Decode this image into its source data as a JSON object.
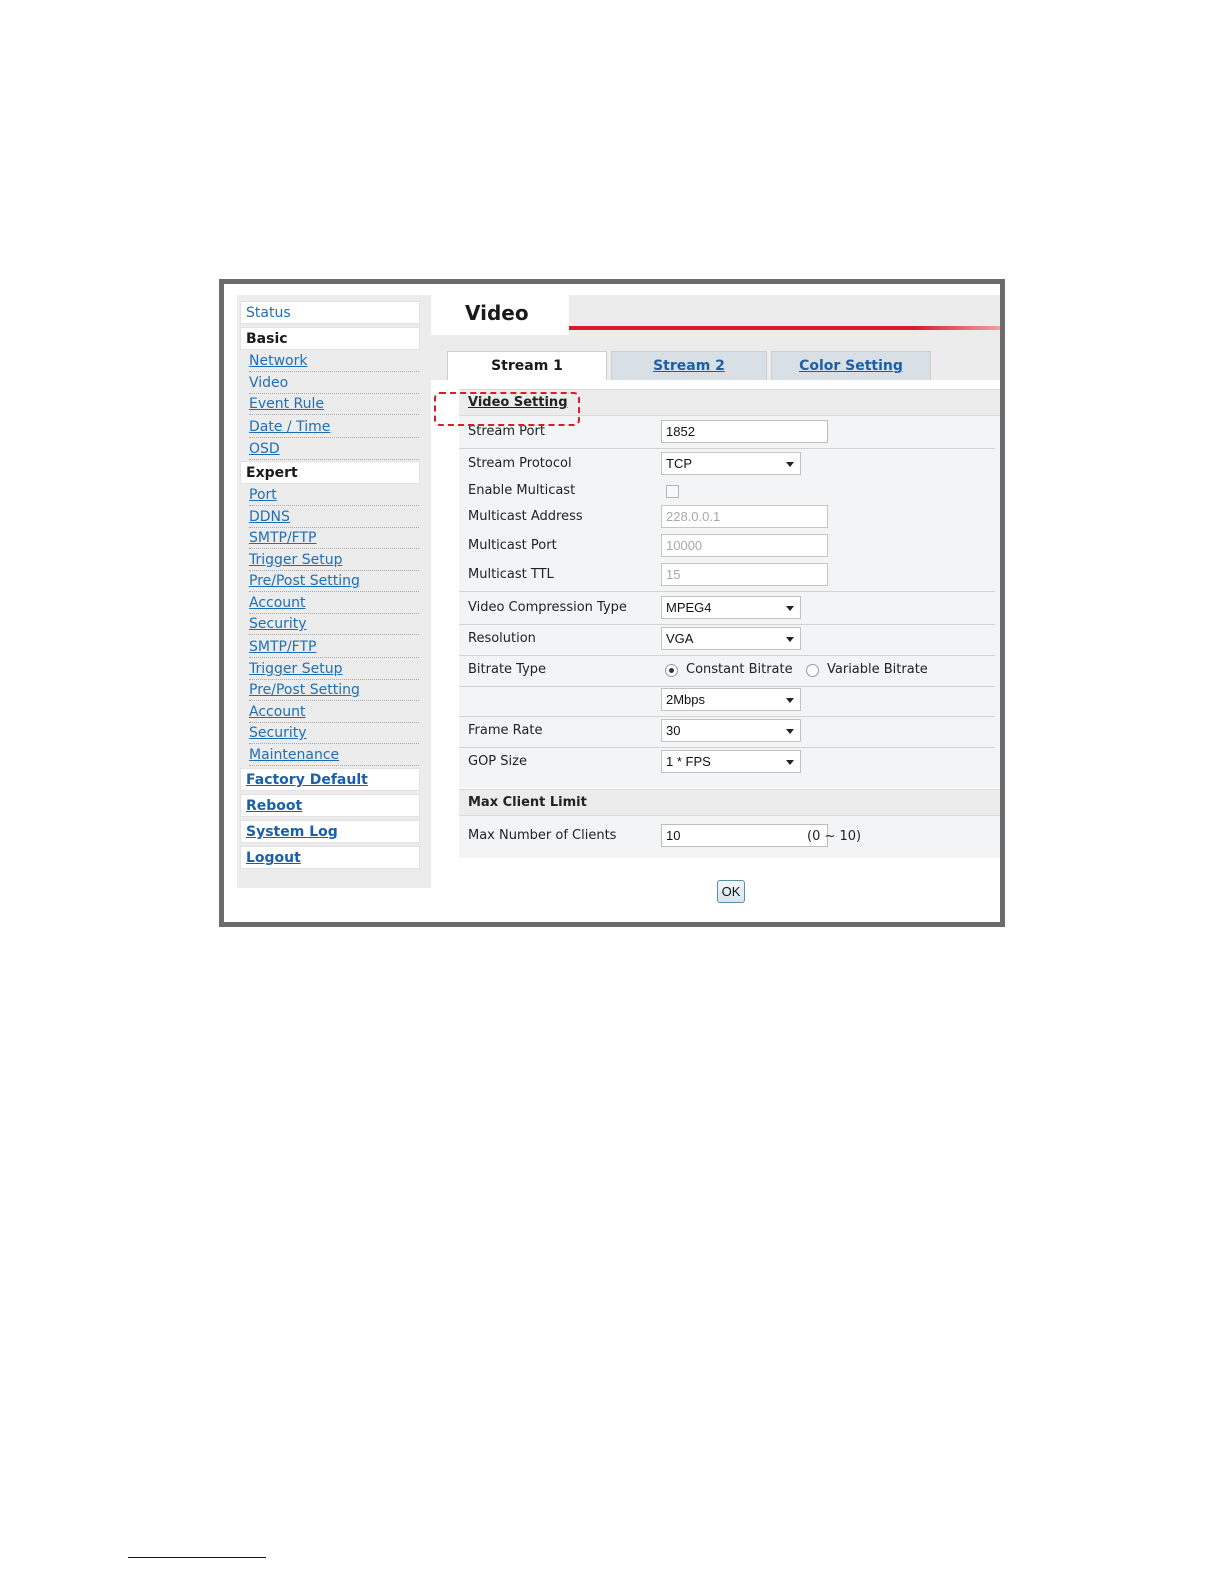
{
  "sidebar": {
    "status": "Status",
    "basic_header": "Basic",
    "basic_items": [
      "Network",
      "Video",
      "Event Rule",
      "Date / Time",
      "OSD"
    ],
    "expert_header": "Expert",
    "expert_items": [
      "Port",
      "DDNS",
      "SMTP/FTP",
      "Trigger Setup",
      "Pre/Post Setting",
      "Account",
      "Security",
      "SMTP/FTP",
      "Trigger Setup",
      "Pre/Post Setting",
      "Account",
      "Security",
      "Maintenance"
    ],
    "factory_default": "Factory Default",
    "reboot": "Reboot",
    "system_log": "System Log",
    "logout": "Logout"
  },
  "page": {
    "title": "Video"
  },
  "tabs": [
    "Stream 1",
    "Stream 2",
    "Color Setting"
  ],
  "video_setting": {
    "header": "Video Setting",
    "stream_port_label": "Stream Port",
    "stream_port_value": "1852",
    "stream_protocol_label": "Stream Protocol",
    "stream_protocol_value": "TCP",
    "enable_multicast_label": "Enable Multicast",
    "multicast_address_label": "Multicast Address",
    "multicast_address_value": "228.0.0.1",
    "multicast_port_label": "Multicast Port",
    "multicast_port_value": "10000",
    "multicast_ttl_label": "Multicast TTL",
    "multicast_ttl_value": "15",
    "compression_label": "Video Compression Type",
    "compression_value": "MPEG4",
    "resolution_label": "Resolution",
    "resolution_value": "VGA",
    "bitrate_type_label": "Bitrate Type",
    "bitrate_constant": "Constant Bitrate",
    "bitrate_variable": "Variable Bitrate",
    "bitrate_value": "2Mbps",
    "frame_rate_label": "Frame Rate",
    "frame_rate_value": "30",
    "gop_label": "GOP Size",
    "gop_value": "1 * FPS"
  },
  "max_client": {
    "header": "Max Client Limit",
    "label": "Max Number of Clients",
    "value": "10",
    "hint": "(0 ~ 10)"
  },
  "ok_label": "OK"
}
